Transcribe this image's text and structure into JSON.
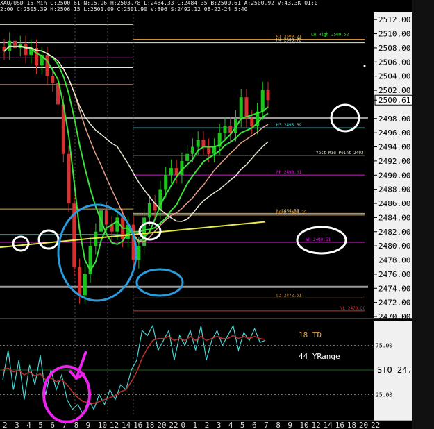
{
  "header": {
    "line1": "XAU/USD 15-Min C:2500.61 N:15.96 H:2503.78 L:2484.33 C:2484.35 B:2500.61 A:2500.92 V:43.3K OI:0",
    "line2": "2:00 C:2505.39 H:2506.15 L:2501.09 C:2501.90 V:896 S:2492.12 08-22-24 5:40"
  },
  "colors": {
    "background": "#000000",
    "price_axis_bg": "#f0f0f0",
    "candle": "#1ec41e",
    "ma_green": "#3ae23a",
    "ma_white": "#e8e8d0",
    "ma_pink": "#e6a08a",
    "stoch_k": "#4ad6d6",
    "stoch_d": "#c0302a",
    "pivot_magenta": "#d81ad8",
    "level_orange": "#e7a43a",
    "level_yellow": "#e8e84a",
    "level_red": "#d83030",
    "annotation_white": "#ffffff",
    "annotation_blue": "#2a9bdc",
    "annotation_magenta": "#ee22ee"
  },
  "chart_data": [
    {
      "type": "line",
      "subtype": "candlestick",
      "title": "XAU/USD 15-Min",
      "ylim": [
        2470,
        2513
      ],
      "y_ticks": [
        "2512.00",
        "2510.00",
        "2508.00",
        "2506.00",
        "2504.00",
        "2502.00",
        "2500.61",
        "2498.00",
        "2496.00",
        "2494.00",
        "2492.00",
        "2490.00",
        "2488.00",
        "2486.00",
        "2484.00",
        "2482.00",
        "2480.00",
        "2478.00",
        "2476.00",
        "2474.00",
        "2472.00",
        "2470.00"
      ],
      "current_price": 2500.61,
      "x_ticks": [
        "2",
        "3",
        "4",
        "5",
        "6",
        "7",
        "8",
        "9",
        "10",
        "12",
        "14",
        "16",
        "18",
        "20",
        "22",
        "0",
        "1",
        "2",
        "3",
        "4",
        "5",
        "6",
        "7",
        "8",
        "9",
        "10",
        "12",
        "14",
        "16",
        "18",
        "20",
        "22"
      ],
      "series": [
        {
          "name": "close",
          "values": [
            2507.5,
            2509,
            2508,
            2508.5,
            2507,
            2508,
            2505.5,
            2507,
            2504,
            2503,
            2500,
            2493,
            2486,
            2477,
            2473,
            2476,
            2480,
            2482,
            2485,
            2483,
            2482,
            2484,
            2481,
            2483,
            2478,
            2480,
            2484,
            2486,
            2485,
            2488,
            2490,
            2491,
            2490,
            2492,
            2493,
            2494,
            2495,
            2494,
            2493,
            2494,
            2496,
            2497,
            2496,
            2498,
            2501,
            2498,
            2497,
            2499,
            2502,
            2500.61
          ]
        }
      ],
      "levels": [
        {
          "label": "LW High 2509.52",
          "value": 2509.52,
          "color": "#3ae23a"
        },
        {
          "label": "R1 2509.21",
          "value": 2509.21,
          "color": "#e7a43a"
        },
        {
          "label": "H4 2508.72",
          "value": 2508.72,
          "color": "#e8e8d0"
        },
        {
          "label": "H3 2496.69",
          "value": 2496.69,
          "color": "#4ad6d6"
        },
        {
          "label": "Yest Mid Point 2492",
          "value": 2492.8,
          "color": "#e8e8d0"
        },
        {
          "label": "PP 2490.01",
          "value": 2490.01,
          "color": "#d81ad8"
        },
        {
          "label": "RORR 2484.35",
          "value": 2484.35,
          "color": "#e7a43a"
        },
        {
          "label": "L 2484.59",
          "value": 2484.59,
          "color": "#e7a43a"
        },
        {
          "label": "WP 2480.51",
          "value": 2480.51,
          "color": "#d81ad8"
        },
        {
          "label": "L3 2472.61",
          "value": 2472.61,
          "color": "#e7a43a"
        },
        {
          "label": "YL 2470.80",
          "value": 2470.8,
          "color": "#d83030"
        }
      ]
    },
    {
      "type": "line",
      "title": "STO",
      "ylim": [
        0,
        100
      ],
      "y_ticks": [
        "75.00",
        "25.00"
      ],
      "stoch_label": "STO 24.",
      "series": [
        {
          "name": "%K",
          "values": [
            40,
            70,
            30,
            60,
            20,
            55,
            35,
            65,
            25,
            50,
            30,
            45,
            20,
            10,
            15,
            5,
            20,
            10,
            25,
            15,
            30,
            20,
            35,
            30,
            50,
            60,
            90,
            85,
            95,
            70,
            80,
            90,
            60,
            85,
            75,
            90,
            70,
            95,
            60,
            80,
            90,
            75,
            85,
            95,
            70,
            88,
            80,
            92,
            78,
            80
          ]
        },
        {
          "name": "%D",
          "values": [
            50,
            52,
            48,
            50,
            45,
            48,
            44,
            46,
            40,
            42,
            38,
            40,
            35,
            28,
            22,
            18,
            17,
            16,
            18,
            20,
            22,
            24,
            28,
            30,
            38,
            48,
            62,
            72,
            80,
            82,
            82,
            84,
            80,
            82,
            80,
            84,
            80,
            84,
            80,
            82,
            84,
            82,
            82,
            85,
            82,
            84,
            82,
            84,
            82,
            81
          ]
        }
      ],
      "annotations": [
        "18 TD",
        "44 YRange"
      ]
    }
  ]
}
